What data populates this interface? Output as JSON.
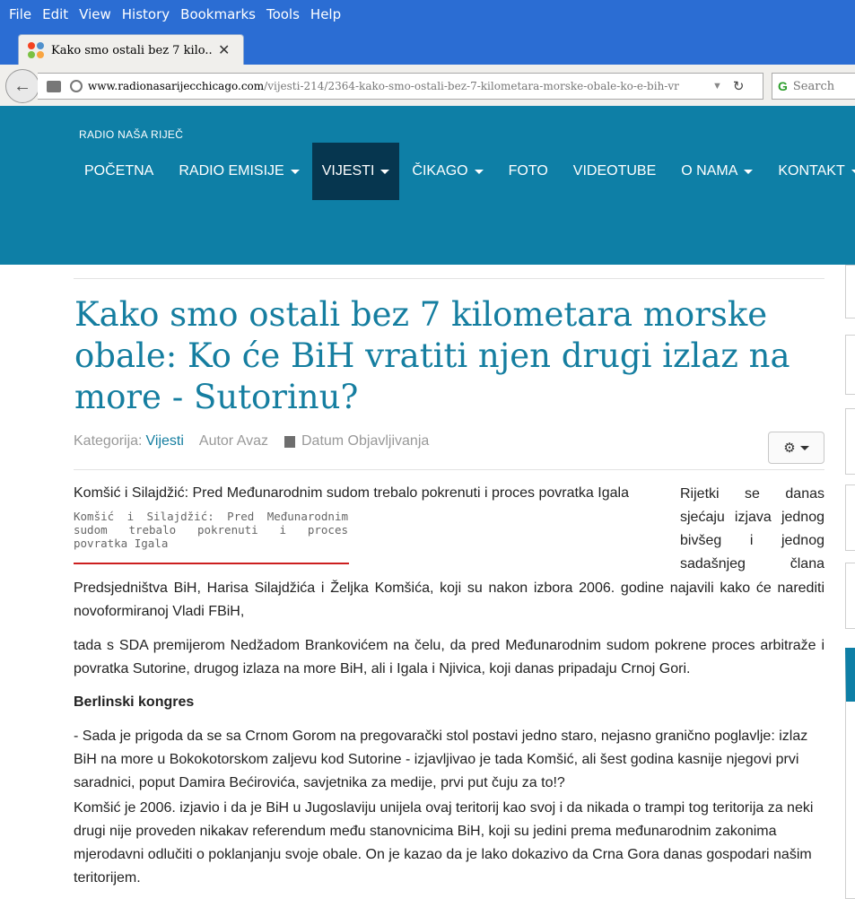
{
  "browser": {
    "menu": [
      "File",
      "Edit",
      "View",
      "History",
      "Bookmarks",
      "Tools",
      "Help"
    ],
    "tab_title": "Kako smo ostali bez 7 kilo...",
    "tab_close": "✕",
    "new_tab": "+",
    "url_domain": "www.radionasarijecchicago.com",
    "url_path": "/vijesti-214/2364-kako-smo-ostali-bez-7-kilometara-morske-obale-ko-e-bih-vr",
    "search_placeholder": "Search"
  },
  "site": {
    "brand": "RADIO NAŠA RIJEČ",
    "nav": [
      {
        "label": "POČETNA",
        "dropdown": false
      },
      {
        "label": "RADIO EMISIJE",
        "dropdown": true
      },
      {
        "label": "VIJESTI",
        "dropdown": true,
        "active": true
      },
      {
        "label": "ČIKAGO",
        "dropdown": true
      },
      {
        "label": "FOTO",
        "dropdown": false
      },
      {
        "label": "VIDEOTUBE",
        "dropdown": false
      },
      {
        "label": "O NAMA",
        "dropdown": true
      },
      {
        "label": "KONTAKT",
        "dropdown": true
      }
    ],
    "colors": {
      "header": "#0e7fa6",
      "active_nav": "#06364f",
      "title": "#157ea0",
      "caption_rule": "#cc1f1f"
    }
  },
  "article": {
    "title": "Kako smo ostali bez 7 kilometara morske obale: Ko će BiH vratiti njen drugi izlaz na more - Sutorinu?",
    "meta": {
      "category_label": "Kategorija:",
      "category": "Vijesti",
      "author": "Autor Avaz",
      "date_label": "Datum Objavljivanja"
    },
    "image_title": "Komšić i Silajdžić: Pred Međunarodnim sudom trebalo pokrenuti i proces povratka Igala",
    "image_caption": "Komšić i Silajdžić: Pred Međunarodnim sudom trebalo pokrenuti i proces povratka Igala",
    "float_lines": [
      "Rijetki se danas",
      "sjećaju izjava jednog",
      "bivšeg i jednog",
      "sadašnjeg člana"
    ],
    "p1": "Predsjedništva BiH, Harisa Silajdžića i Željka Komšića, koji su nakon izbora 2006. godine najavili kako će narediti novoformiranoj Vladi FBiH,",
    "p2": "tada s SDA premijerom Nedžadom Brankovićem na čelu, da pred Međunarodnim sudom pokrene proces arbitraže i povratka Sutorine, drugog izlaza na more BiH, ali i Igala i Njivica, koji danas pripadaju Crnoj Gori.",
    "subheading": "Berlinski kongres",
    "p3": "- Sada je prigoda da se sa Crnom Gorom na pregovarački stol postavi jedno staro, nejasno granično poglavlje: izlaz BiH na more u Bokokotorskom zaljevu kod Sutorine - izjavljivao je tada Komšić, ali šest godina kasnije njegovi prvi saradnici, poput Damira Bećirovića, savjetnika za medije, prvi put čuju za to!?",
    "p4": "Komšić je 2006. izjavio i da je BiH u Jugoslaviju unijela ovaj teritorij kao svoj i da nikada o trampi tog teritorija za neki drugi nije proveden nikakav referendum među stanovnicima BiH, koji su jedini prema međunarodnim zakonima mjerodavni odlučiti o poklanjanju svoje obale. On je kazao da je lako dokazivo da Crna Gora danas gospodari našim teritorijem."
  }
}
